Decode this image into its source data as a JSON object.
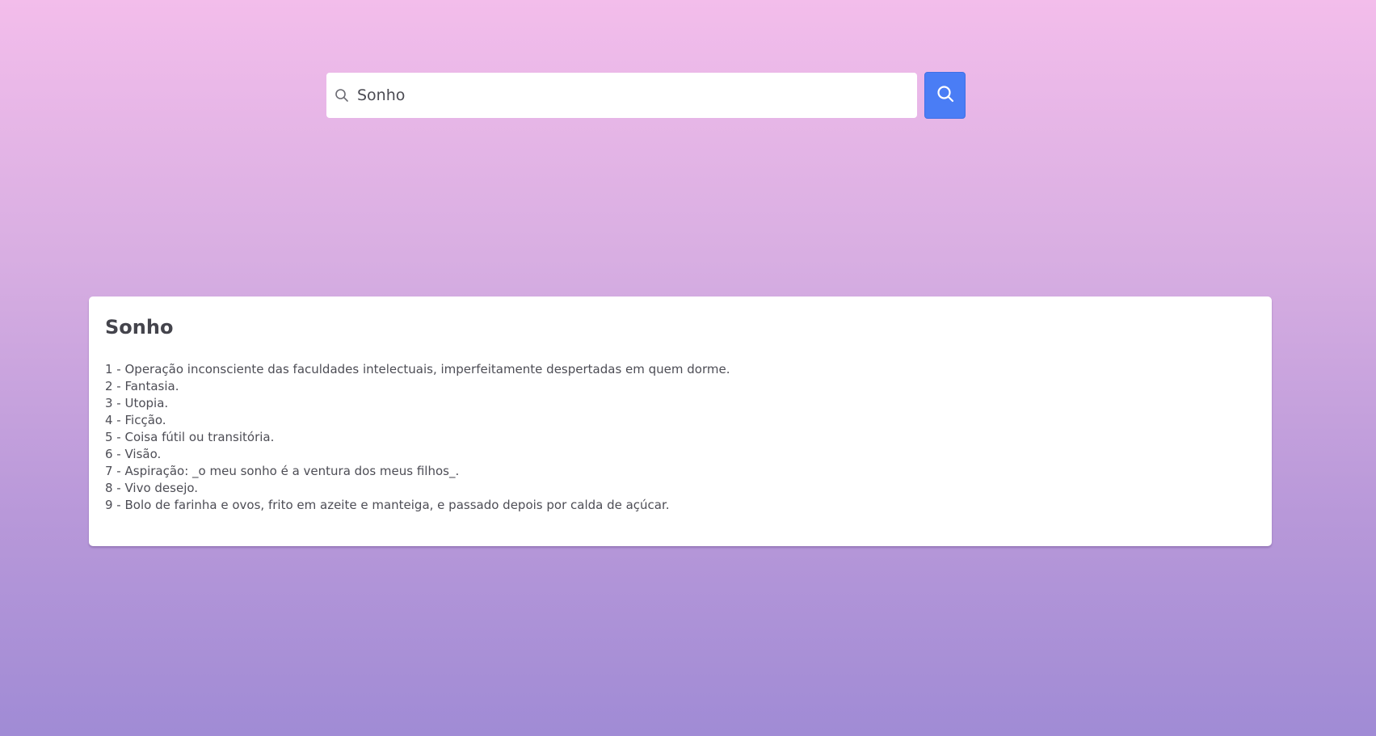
{
  "search": {
    "value": "Sonho"
  },
  "result": {
    "title": "Sonho",
    "definitions": [
      "1 - Operação inconsciente das faculdades intelectuais, imperfeitamente despertadas em quem dorme.",
      "2 - Fantasia.",
      "3 - Utopia.",
      "4 - Ficção.",
      "5 - Coisa fútil ou transitória.",
      "6 - Visão.",
      "7 - Aspiração: _o meu sonho é a ventura dos meus filhos_.",
      "8 - Vivo desejo.",
      "9 - Bolo de farinha e ovos, frito em azeite e manteiga, e passado depois por calda de açúcar."
    ]
  },
  "icons": {
    "input_icon": "search-icon",
    "button_icon": "search-icon"
  },
  "colors": {
    "accent": "#4a7df5",
    "background_top": "#f3bdeb",
    "background_bottom": "#a08bd5",
    "card": "#ffffff"
  }
}
